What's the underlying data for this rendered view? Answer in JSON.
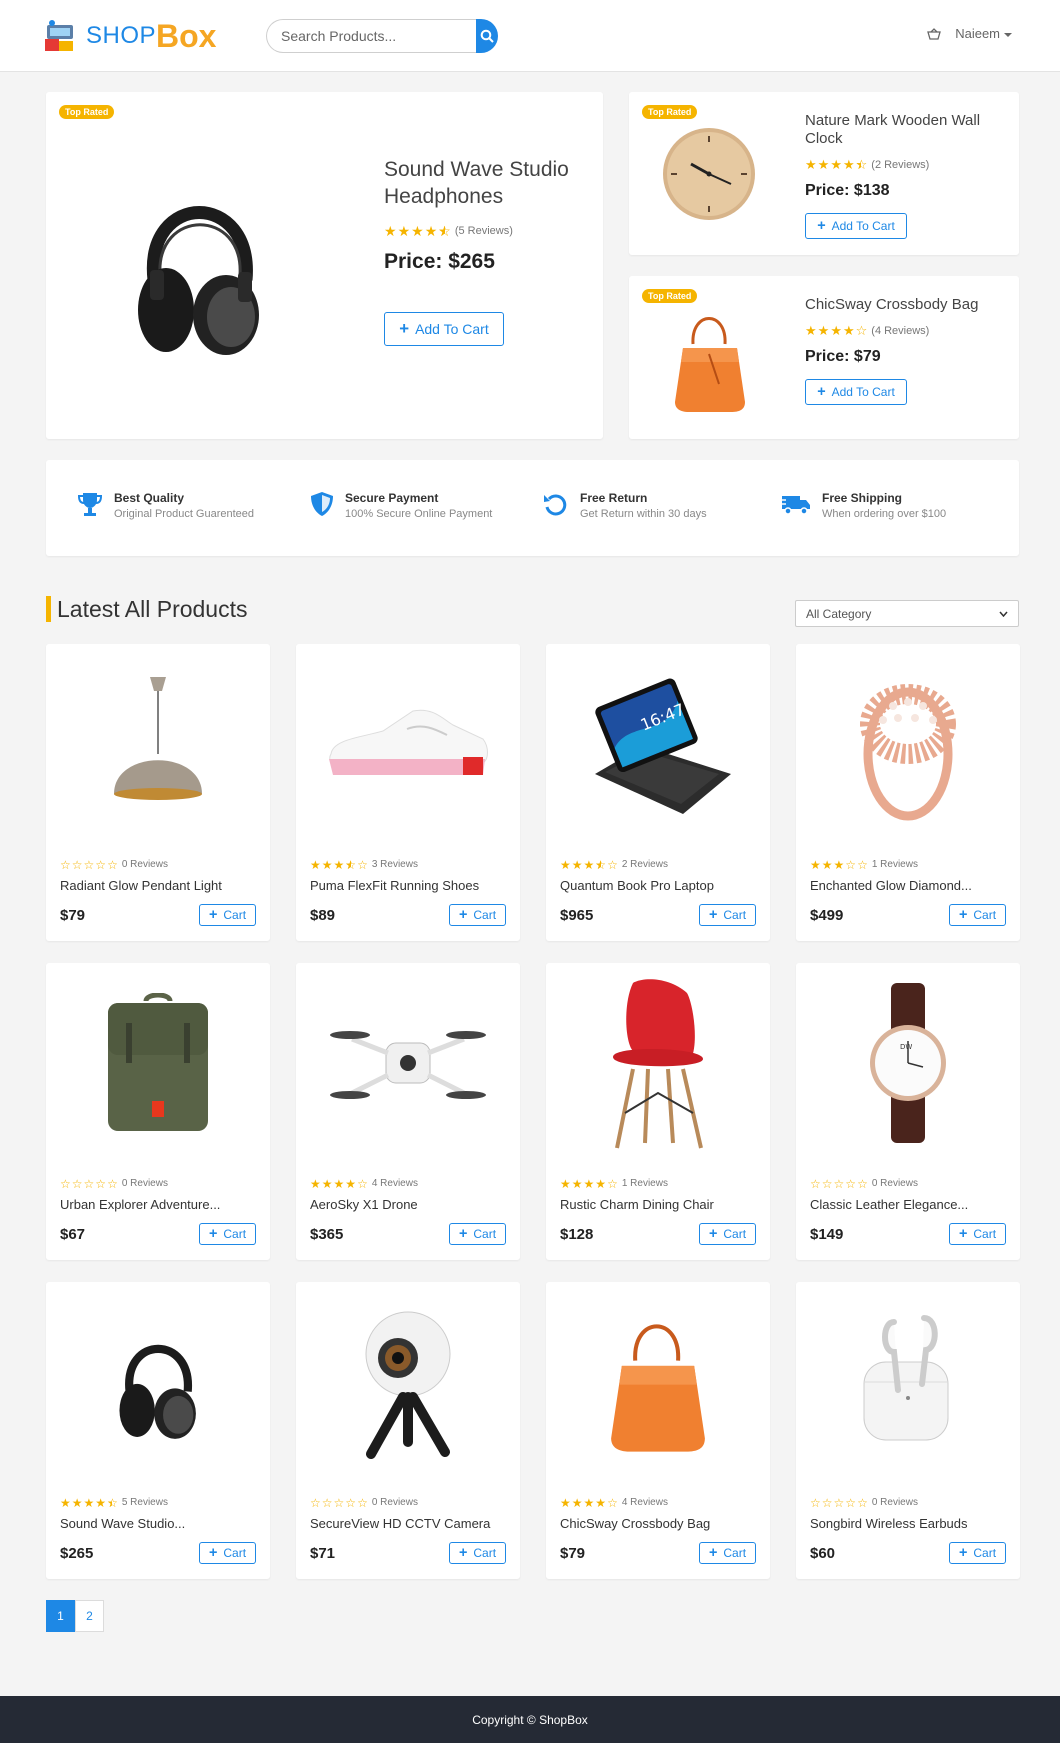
{
  "brand": {
    "part_a": "SHOP",
    "part_b": "Box"
  },
  "search": {
    "placeholder": "Search Products..."
  },
  "user": {
    "name": "Naieem"
  },
  "hero_main": {
    "badge": "Top Rated",
    "title": "Sound Wave Studio Headphones",
    "rating": 4.5,
    "reviews": "(5 Reviews)",
    "price": "Price: $265",
    "cart_label": "Add To Cart",
    "image": "headphones-icon"
  },
  "hero_side": [
    {
      "badge": "Top Rated",
      "title": "Nature Mark Wooden Wall Clock",
      "rating": 4.5,
      "reviews": "(2 Reviews)",
      "price": "Price: $138",
      "cart_label": "Add To Cart",
      "image": "wall-clock-icon"
    },
    {
      "badge": "Top Rated",
      "title": "ChicSway Crossbody Bag",
      "rating": 4,
      "reviews": "(4 Reviews)",
      "price": "Price: $79",
      "cart_label": "Add To Cart",
      "image": "bag-icon"
    }
  ],
  "features": [
    {
      "title": "Best Quality",
      "sub": "Original Product Guarenteed",
      "icon": "trophy-icon"
    },
    {
      "title": "Secure Payment",
      "sub": "100% Secure Online Payment",
      "icon": "shield-icon"
    },
    {
      "title": "Free Return",
      "sub": "Get Return within 30 days",
      "icon": "return-icon"
    },
    {
      "title": "Free Shipping",
      "sub": "When ordering over $100",
      "icon": "truck-icon"
    }
  ],
  "section": {
    "title": "Latest All Products",
    "category_select": "All Category"
  },
  "cart_short": "Cart",
  "products": [
    {
      "name": "Radiant Glow Pendant Light",
      "price": "$79",
      "rating": 0,
      "reviews": "0 Reviews",
      "image": "pendant-lamp-icon"
    },
    {
      "name": "Puma FlexFit Running Shoes",
      "price": "$89",
      "rating": 3.5,
      "reviews": "3 Reviews",
      "image": "sneaker-icon"
    },
    {
      "name": "Quantum Book Pro Laptop",
      "price": "$965",
      "rating": 3.5,
      "reviews": "2 Reviews",
      "image": "tablet-laptop-icon"
    },
    {
      "name": "Enchanted Glow Diamond...",
      "price": "$499",
      "rating": 3,
      "reviews": "1 Reviews",
      "image": "ring-icon"
    },
    {
      "name": "Urban Explorer Adventure...",
      "price": "$67",
      "rating": 0,
      "reviews": "0 Reviews",
      "image": "backpack-icon"
    },
    {
      "name": "AeroSky X1 Drone",
      "price": "$365",
      "rating": 4,
      "reviews": "4 Reviews",
      "image": "drone-icon"
    },
    {
      "name": "Rustic Charm Dining Chair",
      "price": "$128",
      "rating": 4,
      "reviews": "1 Reviews",
      "image": "chair-icon"
    },
    {
      "name": "Classic Leather Elegance...",
      "price": "$149",
      "rating": 0,
      "reviews": "0 Reviews",
      "image": "watch-icon"
    },
    {
      "name": "Sound Wave Studio...",
      "price": "$265",
      "rating": 4.5,
      "reviews": "5 Reviews",
      "image": "headphones-icon"
    },
    {
      "name": "SecureView HD CCTV Camera",
      "price": "$71",
      "rating": 0,
      "reviews": "0 Reviews",
      "image": "camera-icon"
    },
    {
      "name": "ChicSway Crossbody Bag",
      "price": "$79",
      "rating": 4,
      "reviews": "4 Reviews",
      "image": "bag-icon"
    },
    {
      "name": "Songbird Wireless Earbuds",
      "price": "$60",
      "rating": 0,
      "reviews": "0 Reviews",
      "image": "earbuds-icon"
    }
  ],
  "pagination": [
    "1",
    "2"
  ],
  "footer": {
    "text": "Copyright © ShopBox"
  },
  "colors": {
    "accent": "#1e88e5",
    "star": "#f5b400",
    "footer": "#252a35"
  }
}
